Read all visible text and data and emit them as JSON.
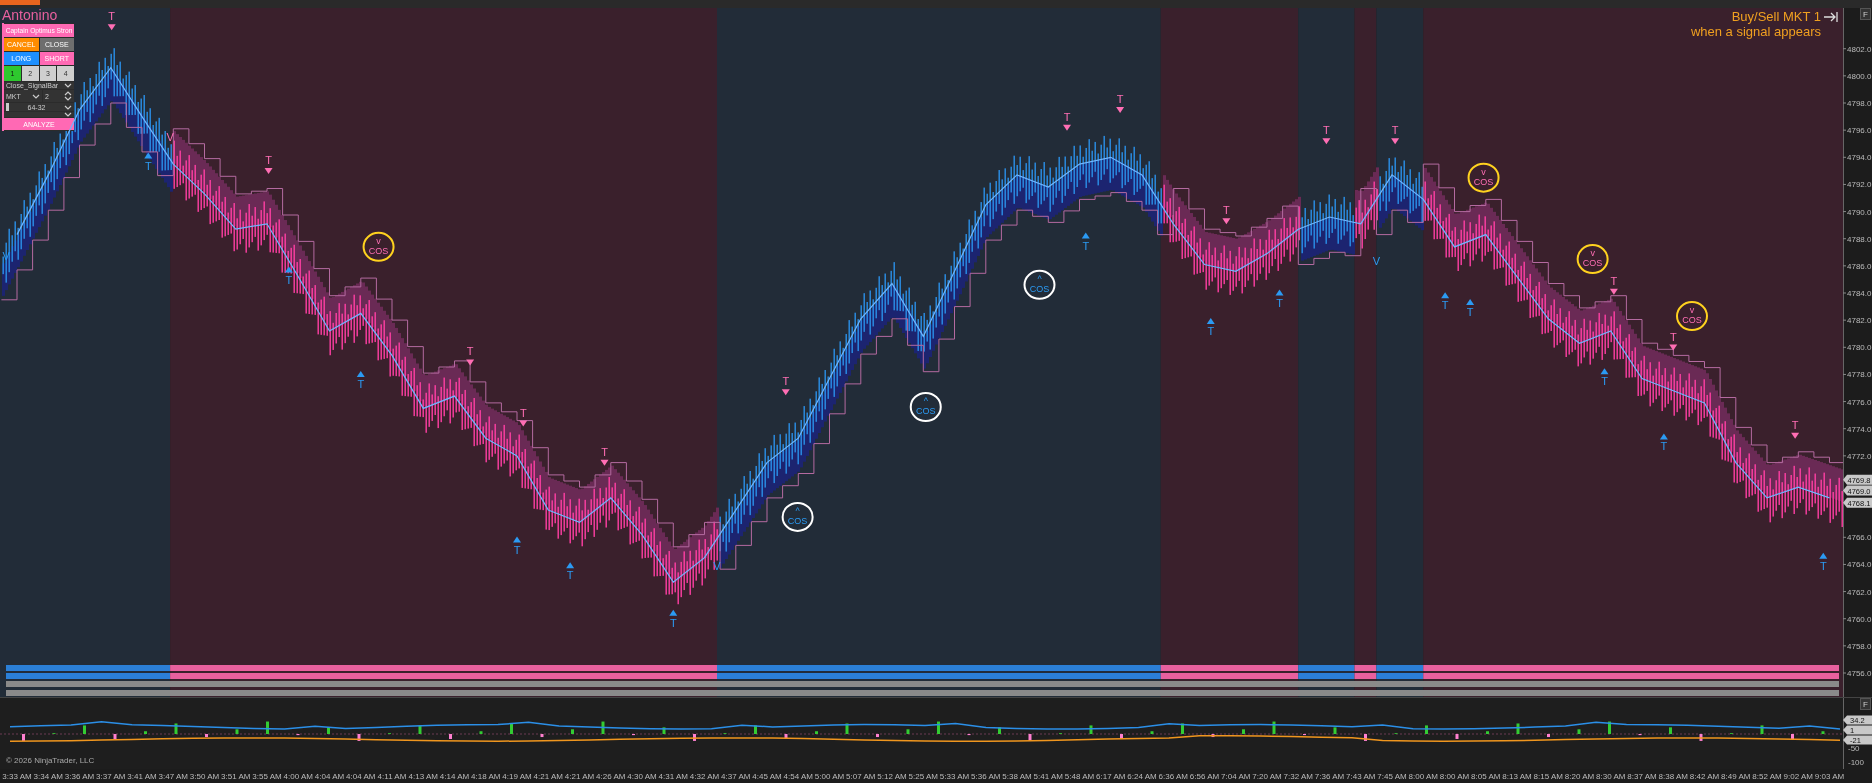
{
  "title": "Antonino",
  "order_panel": {
    "header": "Captain Optimus Stron",
    "buttons": [
      {
        "label": "CANCEL",
        "kind": "cancel"
      },
      {
        "label": "CLOSE",
        "kind": "close"
      },
      {
        "label": "LONG",
        "kind": "long"
      },
      {
        "label": "SHORT",
        "kind": "short"
      }
    ],
    "accounts": [
      {
        "label": "1",
        "selected": true
      },
      {
        "label": "2",
        "selected": false
      },
      {
        "label": "3",
        "selected": false
      },
      {
        "label": "4",
        "selected": false
      }
    ],
    "signal_source": {
      "value": "Close_SignalBar"
    },
    "order_type": {
      "value": "MKT"
    },
    "quantity": {
      "value": "2"
    },
    "preset": {
      "value": "64-32"
    },
    "analyze_button": "ANALYZE"
  },
  "hint": {
    "line_1": "Buy/Sell MKT 1",
    "line_2": "when a signal appears"
  },
  "panel_buttons": [
    "F",
    "F"
  ],
  "price_chart": {
    "chart_data": {
      "type": "line",
      "categories": [
        "3:33 AM",
        "3:34 AM",
        "3:36 AM",
        "3:37 AM",
        "3:41 AM",
        "3:47 AM",
        "3:50 AM",
        "3:51 AM",
        "3:55 AM",
        "4:00 AM",
        "4:04 AM",
        "4:04 AM",
        "4:11 AM",
        "4:13 AM",
        "4:14 AM",
        "4:18 AM",
        "4:19 AM",
        "4:21 AM",
        "4:21 AM",
        "4:26 AM",
        "4:30 AM",
        "4:31 AM",
        "4:32 AM",
        "4:37 AM",
        "4:45 AM",
        "4:54 AM",
        "5:00 AM",
        "5:07 AM",
        "5:12 AM",
        "5:25 AM",
        "5:33 AM",
        "5:36 AM",
        "5:38 AM",
        "5:41 AM",
        "5:48 AM",
        "6:17 AM",
        "6:24 AM",
        "6:36 AM",
        "6:56 AM",
        "7:04 AM",
        "7:20 AM",
        "7:32 AM",
        "7:36 AM",
        "7:43 AM",
        "7:45 AM",
        "8:00 AM",
        "8:00 AM",
        "8:05 AM",
        "8:13 AM",
        "8:15 AM",
        "8:20 AM",
        "8:30 AM",
        "8:37 AM",
        "8:38 AM",
        "8:42 AM",
        "8:49 AM",
        "8:52 AM",
        "9:02 AM",
        "9:03 AM"
      ],
      "series": [
        {
          "color": "#6fb6ff",
          "values": [
            4788.3,
            4792.7,
            4797.5,
            4800.6,
            4797,
            4793.5,
            4791.3,
            4788.7,
            4789.1,
            4785.2,
            4781.2,
            4782.5,
            4779.4,
            4775.5,
            4776.4,
            4773.3,
            4772,
            4768,
            4767.1,
            4768.9,
            4766.2,
            4762.7,
            4764.5,
            4768,
            4771.5,
            4773.3,
            4777.7,
            4782.1,
            4784.7,
            4780.8,
            4785.6,
            4790.5,
            4792.7,
            4791.8,
            4793.5,
            4794,
            4792.7,
            4789.1,
            4786.1,
            4785.6,
            4786.9,
            4788.7,
            4789.6,
            4789.1,
            4792.7,
            4790.9,
            4787.4,
            4788.3,
            4785.2,
            4782.1,
            4780.3,
            4781.2,
            4777.7,
            4776.8,
            4775.9,
            4771.5,
            4768.9,
            4769.7,
            4768.9
          ]
        }
      ],
      "ylim": [
        4749,
        4805
      ],
      "yticks": [
        {
          "value": 4802,
          "label": "4802.0"
        },
        {
          "value": 4800,
          "label": "4800.0"
        },
        {
          "value": 4798,
          "label": "4798.0"
        },
        {
          "value": 4796,
          "label": "4796.0"
        },
        {
          "value": 4794,
          "label": "4794.0"
        },
        {
          "value": 4792,
          "label": "4792.0"
        },
        {
          "value": 4790,
          "label": "4790.0"
        },
        {
          "value": 4788,
          "label": "4788.0"
        },
        {
          "value": 4786,
          "label": "4786.0"
        },
        {
          "value": 4784,
          "label": "4784.0"
        },
        {
          "value": 4782,
          "label": "4782.0"
        },
        {
          "value": 4780,
          "label": "4780.0"
        },
        {
          "value": 4778,
          "label": "4778.0"
        },
        {
          "value": 4776,
          "label": "4776.0"
        },
        {
          "value": 4774,
          "label": "4774.0"
        },
        {
          "value": 4772,
          "label": "4772.0"
        },
        {
          "value": 4766,
          "label": "4766.0"
        },
        {
          "value": 4764,
          "label": "4764.0"
        },
        {
          "value": 4762,
          "label": "4762.0"
        },
        {
          "value": 4760,
          "label": "4760.0"
        },
        {
          "value": 4758,
          "label": "4758.0"
        },
        {
          "value": 4756,
          "label": "4756.0"
        }
      ]
    },
    "price_tags": [
      "4769.8",
      "4769.0",
      "4768.1"
    ]
  },
  "trend_zones": [
    {
      "bullish": true
    },
    {
      "bullish": false
    },
    {
      "bullish": true
    },
    {
      "bullish": false
    },
    {
      "bullish": true
    },
    {
      "bullish": false
    },
    {
      "bullish": true
    },
    {
      "bullish": false
    }
  ],
  "callouts": [
    {
      "text": "COS",
      "arrow": "v",
      "color": "#ffd21f"
    },
    {
      "text": "COS",
      "arrow": "^",
      "color": "#ffffff"
    },
    {
      "text": "COS",
      "arrow": "^",
      "color": "#ffffff"
    },
    {
      "text": "COS",
      "arrow": "^",
      "color": "#ffffff"
    },
    {
      "text": "COS",
      "arrow": "v",
      "color": "#ffd21f"
    },
    {
      "text": "COS",
      "arrow": "v",
      "color": "#ffd21f"
    },
    {
      "text": "COS",
      "arrow": "v",
      "color": "#ffd21f"
    }
  ],
  "signals": [
    {
      "text": "T",
      "kind": "sell"
    },
    {
      "text": "T",
      "kind": "sell"
    },
    {
      "text": "T",
      "kind": "sell"
    },
    {
      "text": "T",
      "kind": "sell"
    },
    {
      "text": "T",
      "kind": "sell"
    },
    {
      "text": "T",
      "kind": "sell"
    },
    {
      "text": "T",
      "kind": "sell"
    },
    {
      "text": "T",
      "kind": "sell"
    },
    {
      "text": "T",
      "kind": "sell"
    },
    {
      "text": "T",
      "kind": "sell"
    },
    {
      "text": "T",
      "kind": "sell"
    },
    {
      "text": "T",
      "kind": "sell"
    },
    {
      "text": "T",
      "kind": "sell"
    },
    {
      "text": "T",
      "kind": "sell"
    },
    {
      "text": "T",
      "kind": "buy"
    },
    {
      "text": "T",
      "kind": "buy"
    },
    {
      "text": "T",
      "kind": "buy"
    },
    {
      "text": "T",
      "kind": "buy"
    },
    {
      "text": "T",
      "kind": "buy"
    },
    {
      "text": "T",
      "kind": "buy"
    },
    {
      "text": "T",
      "kind": "buy"
    },
    {
      "text": "T",
      "kind": "buy"
    },
    {
      "text": "T",
      "kind": "buy"
    },
    {
      "text": "T",
      "kind": "buy"
    },
    {
      "text": "T",
      "kind": "buy"
    },
    {
      "text": "T",
      "kind": "buy"
    },
    {
      "text": "T",
      "kind": "buy"
    },
    {
      "text": "T",
      "kind": "buy"
    },
    {
      "text": "V",
      "kind": "reversal_up"
    },
    {
      "text": "V",
      "kind": "reversal_up"
    },
    {
      "text": "V",
      "kind": "reversal_up"
    },
    {
      "text": "V",
      "kind": "reversal_down"
    }
  ],
  "oscillator": {
    "axis_labels": [
      "-50",
      "-100"
    ],
    "value_tags": [
      "34.2",
      "1",
      "-21"
    ]
  },
  "copyright": "© 2026 NinjaTrader, LLC"
}
